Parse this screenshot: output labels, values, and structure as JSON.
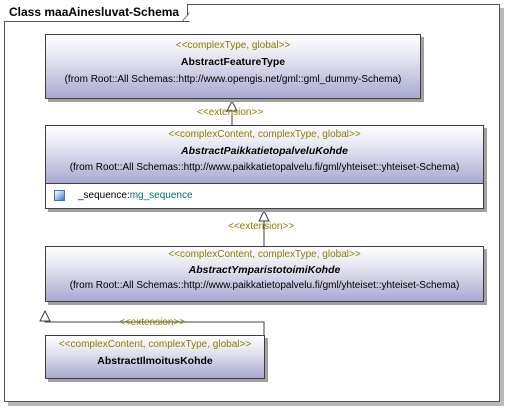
{
  "frame": {
    "title": "Class maaAinesluvat-Schema"
  },
  "classes": [
    {
      "stereotype": "<<complexType, global>>",
      "name": "AbstractFeatureType",
      "origin": "(from Root::All Schemas::http://www.opengis.net/gml::gml_dummy-Schema)"
    },
    {
      "stereotype": "<<complexContent, complexType, global>>",
      "name": "AbstractPaikkatietopalveluKohde",
      "origin": "(from Root::All Schemas::http://www.paikkatietopalvelu.fi/gml/yhteiset::yhteiset-Schema)",
      "attribute": {
        "name": "_sequence",
        "separator": ":",
        "type": "mg_sequence"
      }
    },
    {
      "stereotype": "<<complexContent, complexType, global>>",
      "name": "AbstractYmparistotoimiKohde",
      "origin": "(from Root::All Schemas::http://www.paikkatietopalvelu.fi/gml/yhteiset::yhteiset-Schema)"
    },
    {
      "stereotype": "<<complexContent, complexType, global>>",
      "name": "AbstractIlmoitusKohde"
    }
  ],
  "edges": [
    {
      "label": "<<extension>>"
    },
    {
      "label": "<<extension>>"
    },
    {
      "label": "<<extension>>"
    }
  ]
}
